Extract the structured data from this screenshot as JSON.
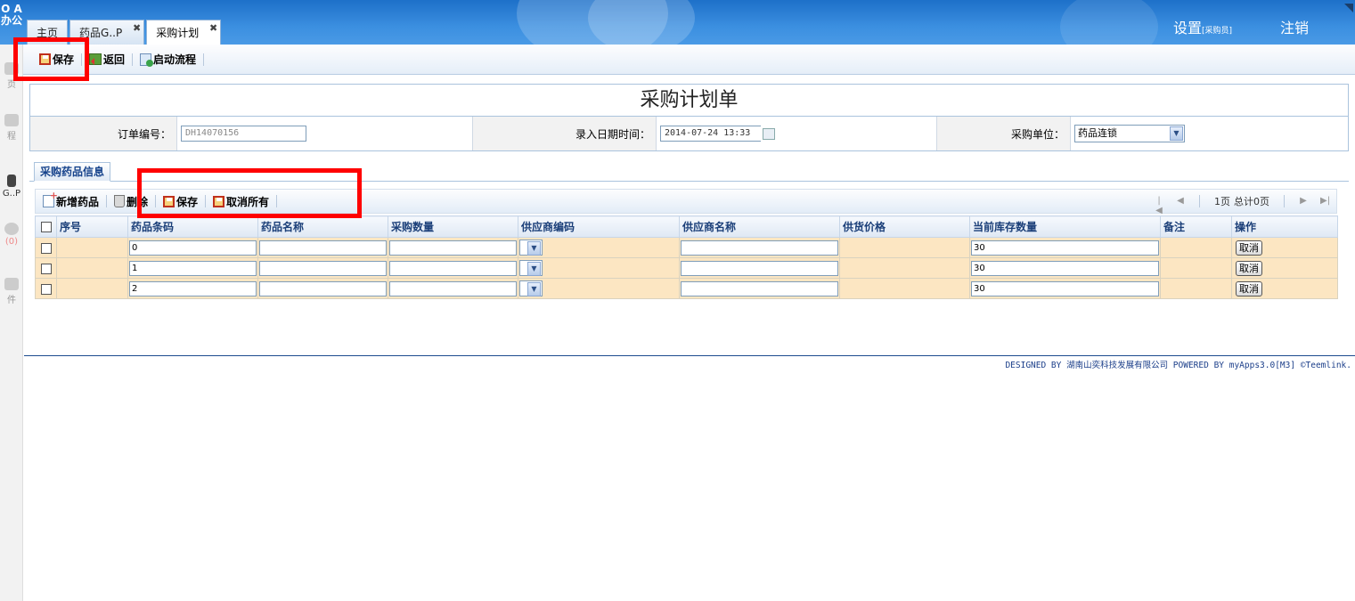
{
  "app": {
    "logo_line1": "O A",
    "logo_line2": "办公",
    "settings_label": "设置",
    "role_label": "[采购员]",
    "logout_label": "注销"
  },
  "tabs": [
    {
      "label": "主页",
      "closable": false
    },
    {
      "label": "药品G..P",
      "closable": true
    },
    {
      "label": "采购计划",
      "closable": true,
      "active": true
    }
  ],
  "tab_close_glyph": "✖",
  "sidebar": {
    "items": [
      {
        "label": "页"
      },
      {
        "label": "程"
      },
      {
        "label": "G..P"
      },
      {
        "label": "(0)"
      },
      {
        "label": "件"
      }
    ]
  },
  "toolbar": {
    "save_label": "保存",
    "back_label": "返回",
    "start_flow_label": "启动流程"
  },
  "form": {
    "title": "采购计划单",
    "order_no_label": "订单编号：",
    "order_no_value": "DH14070156",
    "date_label": "录入日期时间：",
    "date_value": "2014-07-24 13:33",
    "unit_label": "采购单位：",
    "unit_value": "药品连锁"
  },
  "subtab": {
    "label": "采购药品信息"
  },
  "grid_toolbar": {
    "add_label": "新增药品",
    "delete_label": "删除",
    "save_label": "保存",
    "cancel_all_label": "取消所有"
  },
  "pager": {
    "page_label": "1页",
    "total_label": "总计0页"
  },
  "grid": {
    "columns": [
      "序号",
      "药品条码",
      "药品名称",
      "采购数量",
      "供应商编码",
      "供应商名称",
      "供货价格",
      "当前库存数量",
      "备注",
      "操作"
    ],
    "rows": [
      {
        "barcode": "0",
        "stock": "30",
        "action": "取消"
      },
      {
        "barcode": "1",
        "stock": "30",
        "action": "取消"
      },
      {
        "barcode": "2",
        "stock": "30",
        "action": "取消"
      }
    ]
  },
  "footer": {
    "text": "DESIGNED BY 湖南山奕科技发展有限公司 POWERED BY myApps3.0[M3] ©Teemlink."
  },
  "colors": {
    "header_blue": "#2b7fd6",
    "row_bg": "#fce6c2",
    "highlight_red": "#ff0000"
  }
}
